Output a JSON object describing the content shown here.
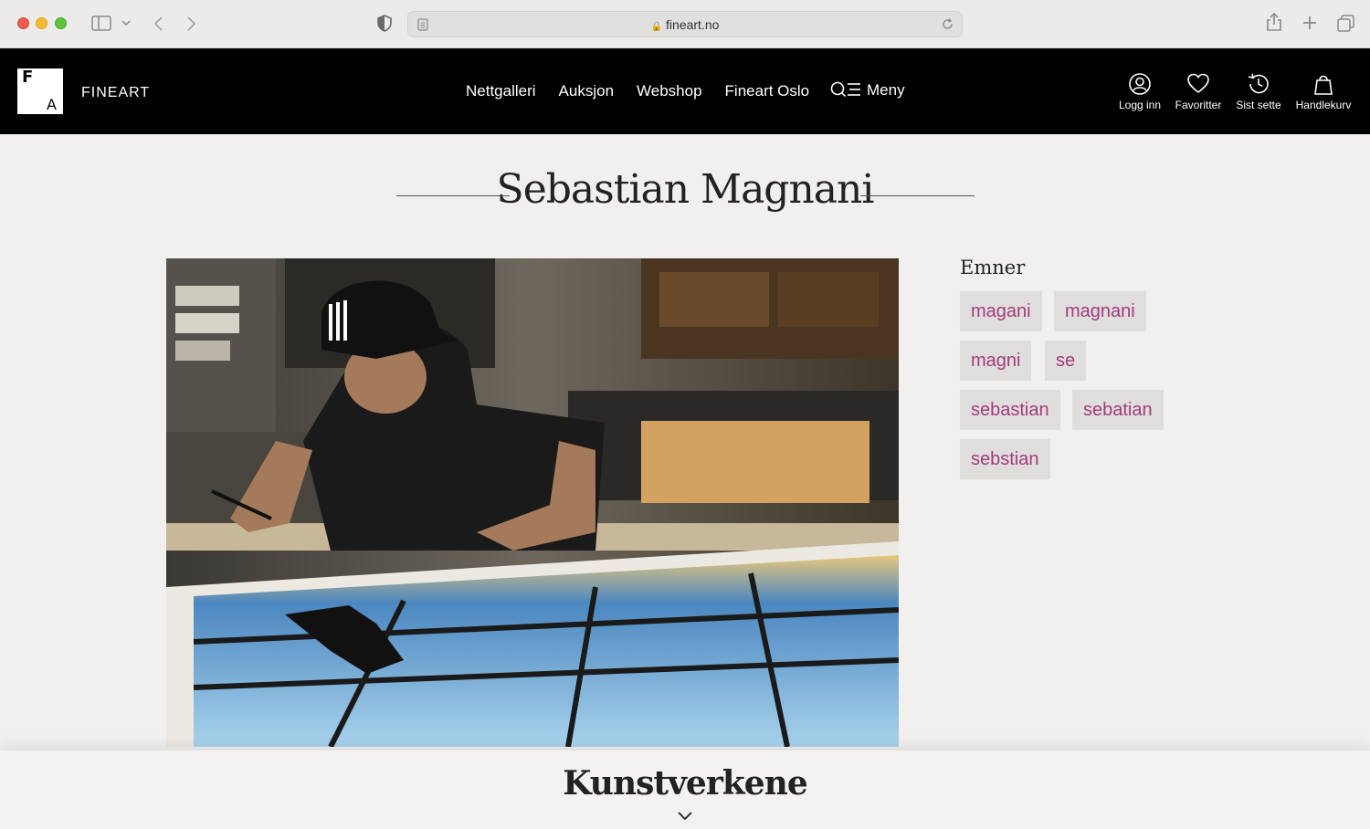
{
  "browser": {
    "url": "fineart.no"
  },
  "header": {
    "brand": "FINEART",
    "logo_letters": {
      "top": "F",
      "bottom": "A"
    },
    "nav": [
      {
        "label": "Nettgalleri"
      },
      {
        "label": "Auksjon"
      },
      {
        "label": "Webshop"
      },
      {
        "label": "Fineart Oslo"
      }
    ],
    "menu_label": "Meny",
    "actions": [
      {
        "label": "Logg inn",
        "icon": "user-circle-icon"
      },
      {
        "label": "Favoritter",
        "icon": "heart-icon"
      },
      {
        "label": "Sist sette",
        "icon": "history-clock-icon"
      },
      {
        "label": "Handlekurv",
        "icon": "shopping-bag-icon"
      }
    ]
  },
  "page": {
    "title": "Sebastian Magnani",
    "tags_heading": "Emner",
    "tags": [
      "magani",
      "magnani",
      "magni",
      "se",
      "sebastian",
      "sebatian",
      "sebstian"
    ],
    "section_title": "Kunstverkene"
  },
  "colors": {
    "header_bg": "#000000",
    "page_bg": "#f1f0ef",
    "tag_bg": "#e0dedd",
    "tag_text": "#a33a7d"
  }
}
